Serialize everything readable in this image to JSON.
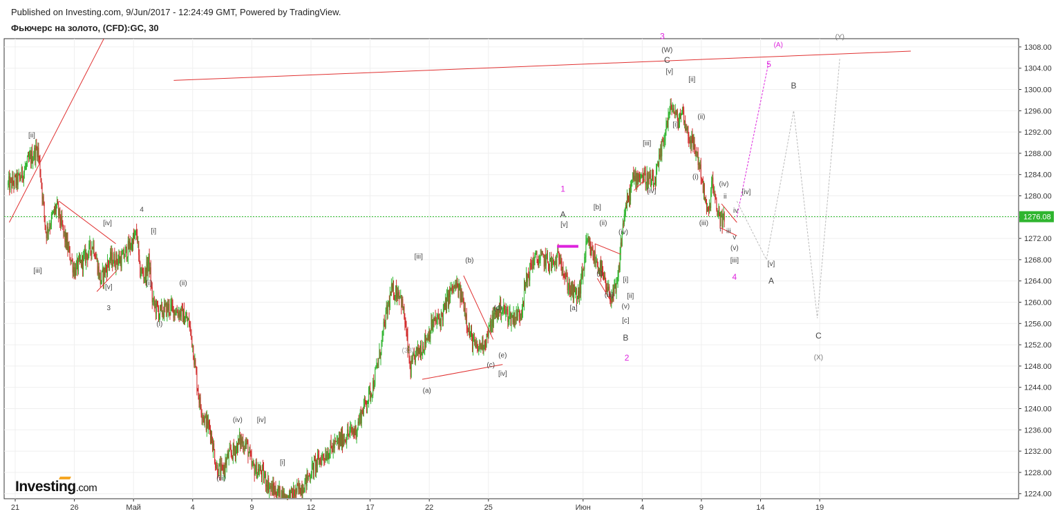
{
  "header": {
    "published": "Published on Investing.com, 9/Jun/2017 - 12:24:49 GMT, Powered by TradingView.",
    "symbol": "Фьючерс на золото, (CFD):GC, 30"
  },
  "logo": {
    "text": "Investing",
    "suffix": ".com"
  },
  "colors": {
    "up": "#2fb52f",
    "down": "#d12a2a",
    "trend": "#e03030",
    "current_price_line": "#22bb22",
    "magenta": "#dd22dd",
    "gray_projection": "#bbbbbb",
    "price_tag_bg": "#2fb52f"
  },
  "chart_data": {
    "type": "candlestick",
    "interval": "30",
    "ylim": [
      1222,
      1310
    ],
    "y_ticks": [
      "1224.00",
      "1228.00",
      "1232.00",
      "1236.00",
      "1240.00",
      "1244.00",
      "1248.00",
      "1252.00",
      "1256.00",
      "1260.00",
      "1264.00",
      "1268.00",
      "1272.00",
      "1276.00",
      "1280.00",
      "1284.00",
      "1288.00",
      "1292.00",
      "1296.00",
      "1300.00",
      "1304.00",
      "1308.00"
    ],
    "x_ticks": [
      {
        "label": "21",
        "t": 0
      },
      {
        "label": "26",
        "t": 5
      },
      {
        "label": "Май",
        "t": 10
      },
      {
        "label": "4",
        "t": 15
      },
      {
        "label": "9",
        "t": 20
      },
      {
        "label": "12",
        "t": 25
      },
      {
        "label": "17",
        "t": 30
      },
      {
        "label": "22",
        "t": 35
      },
      {
        "label": "25",
        "t": 40
      },
      {
        "label": "Июн",
        "t": 48
      },
      {
        "label": "4",
        "t": 53
      },
      {
        "label": "9",
        "t": 58
      },
      {
        "label": "14",
        "t": 63
      },
      {
        "label": "19",
        "t": 68
      }
    ],
    "current_price": 1276.08,
    "current_price_label": "1276.08",
    "price_path": [
      [
        -0.6,
        1282
      ],
      [
        0.3,
        1283
      ],
      [
        1.3,
        1287
      ],
      [
        1.9,
        1289
      ],
      [
        2.1,
        1285
      ],
      [
        2.6,
        1273
      ],
      [
        3.5,
        1278
      ],
      [
        4.2,
        1272
      ],
      [
        5.0,
        1266
      ],
      [
        5.8,
        1268
      ],
      [
        6.6,
        1271
      ],
      [
        7.2,
        1264
      ],
      [
        8.0,
        1268
      ],
      [
        9.0,
        1268
      ],
      [
        9.8,
        1271
      ],
      [
        10.3,
        1273
      ],
      [
        10.5,
        1266
      ],
      [
        11.0,
        1265
      ],
      [
        11.3,
        1268
      ],
      [
        11.6,
        1260
      ],
      [
        12.2,
        1258
      ],
      [
        13.0,
        1259
      ],
      [
        14.0,
        1258
      ],
      [
        14.7,
        1256
      ],
      [
        15.0,
        1252
      ],
      [
        15.3,
        1246
      ],
      [
        15.6,
        1241
      ],
      [
        16.0,
        1238
      ],
      [
        16.5,
        1236
      ],
      [
        17.0,
        1229
      ],
      [
        17.5,
        1228
      ],
      [
        18.0,
        1231
      ],
      [
        18.5,
        1232
      ],
      [
        19.0,
        1234
      ],
      [
        19.6,
        1233
      ],
      [
        20.0,
        1229
      ],
      [
        20.8,
        1228
      ],
      [
        21.6,
        1225
      ],
      [
        22.3,
        1224
      ],
      [
        23.0,
        1223
      ],
      [
        23.6,
        1224
      ],
      [
        24.5,
        1226
      ],
      [
        25.2,
        1229
      ],
      [
        26.0,
        1231
      ],
      [
        27.0,
        1233
      ],
      [
        28.0,
        1235
      ],
      [
        28.8,
        1236
      ],
      [
        29.4,
        1240
      ],
      [
        30.2,
        1244
      ],
      [
        30.8,
        1250
      ],
      [
        31.3,
        1257
      ],
      [
        31.8,
        1262
      ],
      [
        32.5,
        1262
      ],
      [
        32.9,
        1257
      ],
      [
        33.4,
        1247
      ],
      [
        33.8,
        1250
      ],
      [
        34.5,
        1252
      ],
      [
        35.3,
        1256
      ],
      [
        36.0,
        1257
      ],
      [
        36.8,
        1262
      ],
      [
        37.3,
        1263
      ],
      [
        37.9,
        1260
      ],
      [
        38.4,
        1254
      ],
      [
        39.0,
        1251
      ],
      [
        39.8,
        1253
      ],
      [
        40.4,
        1257
      ],
      [
        41.0,
        1259
      ],
      [
        42.0,
        1257
      ],
      [
        42.7,
        1258
      ],
      [
        43.2,
        1264
      ],
      [
        43.8,
        1268
      ],
      [
        44.8,
        1268
      ],
      [
        45.5,
        1267
      ],
      [
        46.1,
        1269
      ],
      [
        46.4,
        1265
      ],
      [
        47.0,
        1262
      ],
      [
        47.6,
        1261
      ],
      [
        48.0,
        1266
      ],
      [
        48.3,
        1271
      ],
      [
        48.8,
        1269
      ],
      [
        49.5,
        1266
      ],
      [
        50.0,
        1262
      ],
      [
        50.5,
        1261
      ],
      [
        50.9,
        1263
      ],
      [
        51.2,
        1271
      ],
      [
        51.5,
        1277
      ],
      [
        51.8,
        1279
      ],
      [
        52.2,
        1283
      ],
      [
        52.8,
        1284
      ],
      [
        53.5,
        1283
      ],
      [
        54.0,
        1282
      ],
      [
        54.5,
        1287
      ],
      [
        55.0,
        1293
      ],
      [
        55.5,
        1297
      ],
      [
        56.0,
        1294
      ],
      [
        56.4,
        1296
      ],
      [
        56.8,
        1292
      ],
      [
        57.2,
        1290
      ],
      [
        57.6,
        1288
      ],
      [
        58.0,
        1284
      ],
      [
        58.3,
        1279
      ],
      [
        58.6,
        1276
      ],
      [
        58.9,
        1283
      ],
      [
        59.2,
        1278
      ],
      [
        59.6,
        1276
      ],
      [
        60.0,
        1275
      ]
    ],
    "annotations": [
      {
        "text": "3",
        "t": 54.7,
        "y": 1309.5,
        "color": "#dd22dd",
        "size": 12
      },
      {
        "text": "(W)",
        "t": 55.1,
        "y": 1307.0,
        "color": "#444"
      },
      {
        "text": "C",
        "t": 55.1,
        "y": 1305.0,
        "color": "#444",
        "size": 12
      },
      {
        "text": "[v]",
        "t": 55.3,
        "y": 1303.0,
        "color": "#444"
      },
      {
        "text": "[ii]",
        "t": 57.2,
        "y": 1301.5,
        "color": "#444"
      },
      {
        "text": "(ii)",
        "t": 58.0,
        "y": 1294.5,
        "color": "#444"
      },
      {
        "text": "[i]",
        "t": 55.8,
        "y": 1293.0,
        "color": "#444"
      },
      {
        "text": "[iii]",
        "t": 53.4,
        "y": 1289.5,
        "color": "#444"
      },
      {
        "text": "(i)",
        "t": 57.5,
        "y": 1283.2,
        "color": "#444"
      },
      {
        "text": "[iv]",
        "t": 53.8,
        "y": 1280.5,
        "color": "#444"
      },
      {
        "text": "(iii)",
        "t": 58.2,
        "y": 1274.5,
        "color": "#444"
      },
      {
        "text": "(iv)",
        "t": 59.9,
        "y": 1281.8,
        "color": "#444"
      },
      {
        "text": "ii",
        "t": 60.0,
        "y": 1279.5,
        "color": "#444"
      },
      {
        "text": "iv",
        "t": 60.9,
        "y": 1276.8,
        "color": "#444"
      },
      {
        "text": "[iv]",
        "t": 61.8,
        "y": 1280.3,
        "color": "#444"
      },
      {
        "text": "i",
        "t": 59.6,
        "y": 1273.3,
        "color": "#444"
      },
      {
        "text": "iii",
        "t": 60.3,
        "y": 1273.0,
        "color": "#444"
      },
      {
        "text": "v",
        "t": 60.8,
        "y": 1271.8,
        "color": "#444"
      },
      {
        "text": "(v)",
        "t": 60.8,
        "y": 1269.8,
        "color": "#444"
      },
      {
        "text": "[iii]",
        "t": 60.8,
        "y": 1267.5,
        "color": "#444"
      },
      {
        "text": "4",
        "t": 60.8,
        "y": 1264.2,
        "color": "#dd22dd",
        "size": 12
      },
      {
        "text": "[v]",
        "t": 63.9,
        "y": 1266.8,
        "color": "#444"
      },
      {
        "text": "A",
        "t": 63.9,
        "y": 1263.5,
        "color": "#444",
        "size": 12
      },
      {
        "text": "5",
        "t": 63.7,
        "y": 1304.2,
        "color": "#dd22dd",
        "size": 12
      },
      {
        "text": "(A)",
        "t": 64.5,
        "y": 1308.0,
        "color": "#dd22dd"
      },
      {
        "text": "(Y)",
        "t": 69.7,
        "y": 1309.5,
        "color": "#777"
      },
      {
        "text": "B",
        "t": 65.8,
        "y": 1300.2,
        "color": "#444",
        "size": 12
      },
      {
        "text": "C",
        "t": 67.9,
        "y": 1253.2,
        "color": "#444",
        "size": 12
      },
      {
        "text": "(X)",
        "t": 67.9,
        "y": 1249.2,
        "color": "#777"
      },
      {
        "text": "1",
        "t": 46.3,
        "y": 1280.8,
        "color": "#dd22dd",
        "size": 12
      },
      {
        "text": "A",
        "t": 46.3,
        "y": 1276.0,
        "color": "#444",
        "size": 12
      },
      {
        "text": "[v]",
        "t": 46.4,
        "y": 1274.2,
        "color": "#444"
      },
      {
        "text": "[b]",
        "t": 49.2,
        "y": 1277.5,
        "color": "#444"
      },
      {
        "text": "(ii)",
        "t": 49.7,
        "y": 1274.5,
        "color": "#444"
      },
      {
        "text": "(iv)",
        "t": 51.4,
        "y": 1272.8,
        "color": "#444"
      },
      {
        "text": "(i)",
        "t": 49.4,
        "y": 1265.0,
        "color": "#444"
      },
      {
        "text": "[i]",
        "t": 51.6,
        "y": 1263.8,
        "color": "#444"
      },
      {
        "text": "(iii)",
        "t": 50.2,
        "y": 1261.0,
        "color": "#444"
      },
      {
        "text": "[ii]",
        "t": 52.0,
        "y": 1260.8,
        "color": "#444"
      },
      {
        "text": "(v)",
        "t": 51.6,
        "y": 1258.8,
        "color": "#444"
      },
      {
        "text": "[c]",
        "t": 51.6,
        "y": 1256.2,
        "color": "#444"
      },
      {
        "text": "B",
        "t": 51.6,
        "y": 1252.8,
        "color": "#444",
        "size": 12
      },
      {
        "text": "2",
        "t": 51.7,
        "y": 1249.0,
        "color": "#dd22dd",
        "size": 12
      },
      {
        "text": "[a]",
        "t": 47.2,
        "y": 1258.5,
        "color": "#444"
      },
      {
        "text": "[iii]",
        "t": 34.1,
        "y": 1268.2,
        "color": "#444"
      },
      {
        "text": "(b)",
        "t": 38.4,
        "y": 1267.5,
        "color": "#444"
      },
      {
        "text": "(d)",
        "t": 40.8,
        "y": 1258.5,
        "color": "#444"
      },
      {
        "text": "(33)",
        "t": 33.2,
        "y": 1250.5,
        "color": "#999"
      },
      {
        "text": "(e)",
        "t": 41.2,
        "y": 1249.6,
        "color": "#444"
      },
      {
        "text": "(c)",
        "t": 40.2,
        "y": 1247.8,
        "color": "#444"
      },
      {
        "text": "[iv]",
        "t": 41.2,
        "y": 1246.2,
        "color": "#444"
      },
      {
        "text": "(a)",
        "t": 34.8,
        "y": 1243.0,
        "color": "#444"
      },
      {
        "text": "[ii]",
        "t": 1.4,
        "y": 1291.0,
        "color": "#444"
      },
      {
        "text": "[iii]",
        "t": 1.9,
        "y": 1265.5,
        "color": "#444"
      },
      {
        "text": "[iv]",
        "t": 7.8,
        "y": 1274.5,
        "color": "#444"
      },
      {
        "text": "[v]",
        "t": 7.9,
        "y": 1262.5,
        "color": "#444"
      },
      {
        "text": "3",
        "t": 7.9,
        "y": 1258.5,
        "color": "#444"
      },
      {
        "text": "4",
        "t": 10.7,
        "y": 1277.0,
        "color": "#444"
      },
      {
        "text": "[i]",
        "t": 11.7,
        "y": 1273.0,
        "color": "#444"
      },
      {
        "text": "[i]",
        "t": 11.3,
        "y": 1263.2,
        "color": "#444"
      },
      {
        "text": "(ii)",
        "t": 14.2,
        "y": 1263.2,
        "color": "#444"
      },
      {
        "text": "(i)",
        "t": 12.2,
        "y": 1255.5,
        "color": "#444"
      },
      {
        "text": "(iv)",
        "t": 18.8,
        "y": 1237.5,
        "color": "#444"
      },
      {
        "text": "[iv]",
        "t": 20.8,
        "y": 1237.5,
        "color": "#444"
      },
      {
        "text": "[i]",
        "t": 22.6,
        "y": 1229.5,
        "color": "#444"
      },
      {
        "text": "(iii)",
        "t": 17.4,
        "y": 1226.5,
        "color": "#444"
      }
    ],
    "trendlines": [
      {
        "from": [
          -0.5,
          1275
        ],
        "to": [
          7.6,
          1310
        ],
        "color": "#e03030"
      },
      {
        "from": [
          13.4,
          1301.7
        ],
        "to": [
          75.7,
          1307.2
        ],
        "color": "#e03030"
      },
      {
        "from": [
          3.7,
          1279
        ],
        "to": [
          8.5,
          1271
        ],
        "color": "#e03030"
      },
      {
        "from": [
          6.9,
          1262
        ],
        "to": [
          8.6,
          1266
        ],
        "color": "#e03030"
      },
      {
        "from": [
          34.4,
          1245.5
        ],
        "to": [
          41.2,
          1248.3
        ],
        "color": "#e03030"
      },
      {
        "from": [
          37.9,
          1265
        ],
        "to": [
          40.4,
          1253
        ],
        "color": "#e03030"
      },
      {
        "from": [
          49.0,
          1271
        ],
        "to": [
          51.2,
          1269
        ],
        "color": "#e03030"
      },
      {
        "from": [
          49.2,
          1264.5
        ],
        "to": [
          50.4,
          1260
        ],
        "color": "#e03030"
      },
      {
        "from": [
          52.3,
          1281
        ],
        "to": [
          53.2,
          1283
        ],
        "color": "#e03030"
      },
      {
        "from": [
          59.6,
          1274.0
        ],
        "to": [
          61.0,
          1272.5
        ],
        "color": "#e03030"
      },
      {
        "from": [
          59.7,
          1278.5
        ],
        "to": [
          61.0,
          1275.0
        ],
        "color": "#e03030"
      }
    ],
    "projections": [
      {
        "points": [
          [
            61.0,
            1276
          ],
          [
            63.7,
            1305.2
          ]
        ],
        "color": "#dd22dd",
        "dash": "3,2"
      },
      {
        "points": [
          [
            61.0,
            1279
          ],
          [
            63.5,
            1268
          ],
          [
            65.8,
            1296
          ],
          [
            67.8,
            1257
          ],
          [
            69.7,
            1306
          ]
        ],
        "color": "#bbbbbb",
        "dash": "3,2"
      }
    ],
    "marker": {
      "from": [
        45.8,
        1270.5
      ],
      "to": [
        47.6,
        1270.5
      ],
      "color": "#dd22dd"
    }
  }
}
